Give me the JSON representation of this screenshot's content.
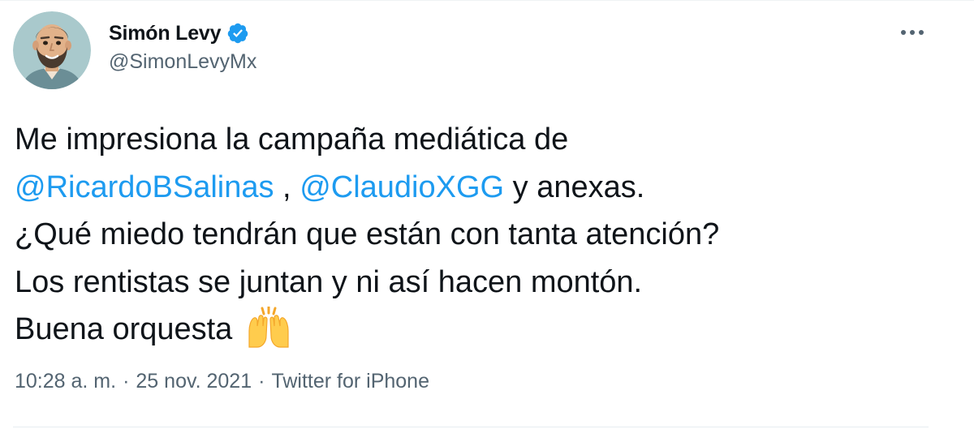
{
  "author": {
    "display_name": "Simón Levy",
    "handle": "@SimonLevyMx",
    "verified": true
  },
  "tweet": {
    "line1": "Me impresiona la campaña mediática de",
    "mention1": "@RicardoBSalinas",
    "between_mentions": " , ",
    "mention2": "@ClaudioXGG",
    "after_mentions": " y anexas.",
    "line3": "¿Qué miedo tendrán que están con tanta atención?",
    "line4": "Los rentistas se juntan y ni así hacen montón.",
    "line5": "Buena orquesta",
    "emoji": "raising-hands-emoji"
  },
  "meta": {
    "time": "10:28 a. m.",
    "separator": "·",
    "date": "25 nov. 2021",
    "source": "Twitter for iPhone"
  },
  "icons": {
    "verified": "verified-badge-icon",
    "more": "more-options-icon"
  },
  "colors": {
    "mention": "#1d9bf0",
    "verified": "#1d9bf0",
    "secondary_text": "#536471",
    "primary_text": "#0f1419"
  }
}
